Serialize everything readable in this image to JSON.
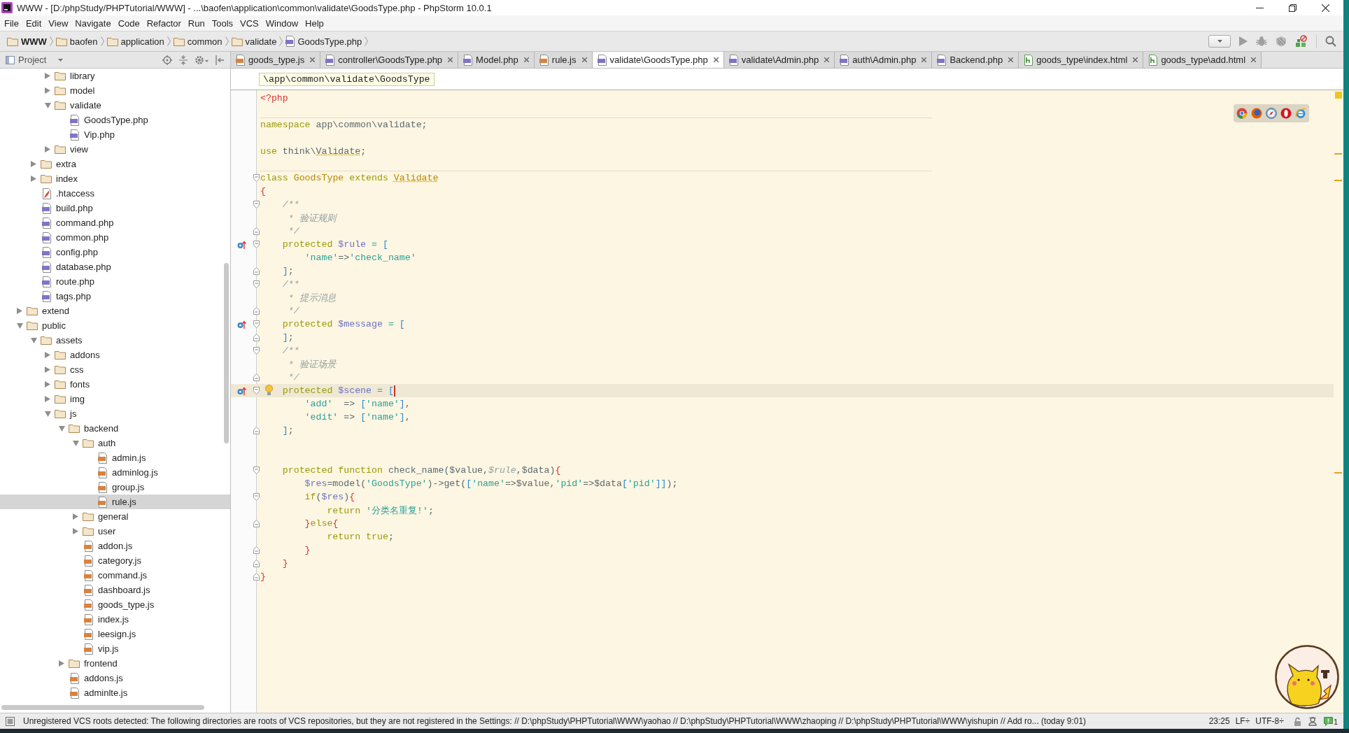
{
  "window": {
    "title": "WWW - [D:/phpStudy/PHPTutorial/WWW] - ...\\baofen\\application\\common\\validate\\GoodsType.php - PhpStorm 10.0.1"
  },
  "menu": [
    "File",
    "Edit",
    "View",
    "Navigate",
    "Code",
    "Refactor",
    "Run",
    "Tools",
    "VCS",
    "Window",
    "Help"
  ],
  "breadcrumb": [
    {
      "label": "WWW",
      "kind": "project"
    },
    {
      "label": "baofen",
      "kind": "folder"
    },
    {
      "label": "application",
      "kind": "folder"
    },
    {
      "label": "common",
      "kind": "folder"
    },
    {
      "label": "validate",
      "kind": "folder"
    },
    {
      "label": "GoodsType.php",
      "kind": "php"
    }
  ],
  "project_panel": {
    "view": "Project",
    "tree": [
      {
        "children": [
          {
            "children": [
              {
                "label": "library",
                "kind": "folder",
                "expanded": false,
                "selected": false
              },
              {
                "label": "model",
                "kind": "folder",
                "expanded": false,
                "selected": false
              },
              {
                "label": "validate",
                "kind": "folder",
                "expanded": true,
                "selected": false,
                "children": [
                  {
                    "label": "GoodsType.php",
                    "kind": "php",
                    "selected": false
                  },
                  {
                    "label": "Vip.php",
                    "kind": "php",
                    "selected": false
                  }
                ]
              },
              {
                "label": "view",
                "kind": "folder",
                "expanded": false,
                "selected": false
              }
            ]
          },
          {
            "label": "extra",
            "kind": "folder",
            "expanded": false,
            "selected": false
          },
          {
            "label": "index",
            "kind": "folder",
            "expanded": false,
            "selected": false
          },
          {
            "label": ".htaccess",
            "kind": "config",
            "selected": false
          },
          {
            "label": "build.php",
            "kind": "php",
            "selected": false
          },
          {
            "label": "command.php",
            "kind": "php",
            "selected": false
          },
          {
            "label": "common.php",
            "kind": "php",
            "selected": false
          },
          {
            "label": "config.php",
            "kind": "php",
            "selected": false
          },
          {
            "label": "database.php",
            "kind": "php",
            "selected": false
          },
          {
            "label": "route.php",
            "kind": "php",
            "selected": false
          },
          {
            "label": "tags.php",
            "kind": "php",
            "selected": false
          }
        ]
      },
      {
        "label": "extend",
        "kind": "folder",
        "expanded": false,
        "selected": false
      },
      {
        "label": "public",
        "kind": "folder",
        "expanded": true,
        "selected": false,
        "children": [
          {
            "label": "assets",
            "kind": "folder",
            "expanded": true,
            "selected": false,
            "children": [
              {
                "label": "addons",
                "kind": "folder",
                "expanded": false,
                "selected": false
              },
              {
                "label": "css",
                "kind": "folder",
                "expanded": false,
                "selected": false
              },
              {
                "label": "fonts",
                "kind": "folder",
                "expanded": false,
                "selected": false
              },
              {
                "label": "img",
                "kind": "folder",
                "expanded": false,
                "selected": false
              },
              {
                "label": "js",
                "kind": "folder",
                "expanded": true,
                "selected": false,
                "children": [
                  {
                    "label": "backend",
                    "kind": "folder",
                    "expanded": true,
                    "selected": false,
                    "children": [
                      {
                        "label": "auth",
                        "kind": "folder",
                        "expanded": true,
                        "selected": false,
                        "children": [
                          {
                            "label": "admin.js",
                            "kind": "js",
                            "selected": false
                          },
                          {
                            "label": "adminlog.js",
                            "kind": "js",
                            "selected": false
                          },
                          {
                            "label": "group.js",
                            "kind": "js",
                            "selected": false
                          },
                          {
                            "label": "rule.js",
                            "kind": "js",
                            "selected": true
                          }
                        ]
                      },
                      {
                        "label": "general",
                        "kind": "folder",
                        "expanded": false,
                        "selected": false
                      },
                      {
                        "label": "user",
                        "kind": "folder",
                        "expanded": false,
                        "selected": false
                      },
                      {
                        "label": "addon.js",
                        "kind": "js",
                        "selected": false
                      },
                      {
                        "label": "category.js",
                        "kind": "js",
                        "selected": false
                      },
                      {
                        "label": "command.js",
                        "kind": "js",
                        "selected": false
                      },
                      {
                        "label": "dashboard.js",
                        "kind": "js",
                        "selected": false
                      },
                      {
                        "label": "goods_type.js",
                        "kind": "js",
                        "selected": false
                      },
                      {
                        "label": "index.js",
                        "kind": "js",
                        "selected": false
                      },
                      {
                        "label": "leesign.js",
                        "kind": "js",
                        "selected": false
                      },
                      {
                        "label": "vip.js",
                        "kind": "js",
                        "selected": false
                      }
                    ]
                  },
                  {
                    "label": "frontend",
                    "kind": "folder",
                    "expanded": false,
                    "selected": false
                  },
                  {
                    "label": "addons.js",
                    "kind": "js",
                    "selected": false
                  },
                  {
                    "label": "adminlte.js",
                    "kind": "js",
                    "selected": false
                  }
                ]
              }
            ]
          }
        ]
      }
    ]
  },
  "tabs": [
    {
      "label": "goods_type.js",
      "kind": "js",
      "selected": false
    },
    {
      "label": "controller\\GoodsType.php",
      "kind": "php",
      "selected": false
    },
    {
      "label": "Model.php",
      "kind": "php",
      "selected": false
    },
    {
      "label": "rule.js",
      "kind": "js",
      "selected": false
    },
    {
      "label": "validate\\GoodsType.php",
      "kind": "php",
      "selected": true
    },
    {
      "label": "validate\\Admin.php",
      "kind": "php",
      "selected": false
    },
    {
      "label": "auth\\Admin.php",
      "kind": "php",
      "selected": false
    },
    {
      "label": "Backend.php",
      "kind": "php",
      "selected": false
    },
    {
      "label": "goods_type\\index.html",
      "kind": "html",
      "selected": false
    },
    {
      "label": "goods_type\\add.html",
      "kind": "html",
      "selected": false
    }
  ],
  "editor": {
    "path_hint": "\\app\\common\\validate\\GoodsType",
    "lines": [
      {
        "tokens": [
          {
            "text": "<?php",
            "kind": "tag"
          }
        ],
        "current": false,
        "separator": false,
        "warning": false
      },
      {
        "current": false,
        "separator": false,
        "warning": false
      },
      {
        "tokens": [
          {
            "text": "namespace",
            "kind": "keyword"
          },
          {
            "text": " app\\common\\validate;",
            "kind": "plain"
          }
        ],
        "current": false,
        "separator": true,
        "warning": false
      },
      {
        "current": false,
        "separator": false,
        "warning": false
      },
      {
        "tokens": [
          {
            "text": "use",
            "kind": "keyword"
          },
          {
            "text": " think\\",
            "kind": "plain"
          },
          {
            "text": "Validate",
            "kind": "ref"
          },
          {
            "text": ";",
            "kind": "plain"
          }
        ],
        "current": false,
        "separator": false,
        "warning": true
      },
      {
        "current": false,
        "separator": false,
        "warning": false
      },
      {
        "markers": [
          {
            "kind": "foldstart"
          }
        ],
        "tokens": [
          {
            "text": "class ",
            "kind": "keyword"
          },
          {
            "text": "GoodsType",
            "kind": "type"
          },
          {
            "text": " extends ",
            "kind": "keyword"
          },
          {
            "text": "Validate",
            "kind": "typeref"
          }
        ],
        "current": false,
        "separator": true,
        "warning": true
      },
      {
        "tokens": [
          {
            "text": "{",
            "kind": "brace"
          }
        ],
        "current": false,
        "separator": false,
        "warning": false,
        "children": [
          {
            "markers": [
              {
                "kind": "foldstart"
              }
            ],
            "tokens": [
              {
                "text": "/**",
                "kind": "comment"
              }
            ],
            "current": false,
            "separator": false,
            "warning": false
          },
          {
            "tokens": [
              {
                "text": " * 验证规则",
                "kind": "comment"
              }
            ],
            "current": false,
            "separator": false,
            "warning": false
          },
          {
            "markers": [
              {
                "kind": "foldend"
              }
            ],
            "tokens": [
              {
                "text": " */",
                "kind": "comment"
              }
            ],
            "current": false,
            "separator": false,
            "warning": false
          },
          {
            "markers": [
              {
                "kind": "override"
              },
              {
                "kind": "foldstart"
              }
            ],
            "tokens": [
              {
                "text": "protected ",
                "kind": "keyword"
              },
              {
                "text": "$rule",
                "kind": "variable"
              },
              {
                "text": " = ",
                "kind": "operator"
              },
              {
                "text": "[",
                "kind": "bracket"
              }
            ],
            "current": false,
            "separator": false,
            "warning": false,
            "children": [
              {
                "tokens": [
                  {
                    "text": "'name'",
                    "kind": "string"
                  },
                  {
                    "text": "=>",
                    "kind": "plain"
                  },
                  {
                    "text": "'check_name'",
                    "kind": "string"
                  }
                ],
                "current": false,
                "separator": false,
                "warning": false
              }
            ]
          },
          {
            "markers": [
              {
                "kind": "foldend"
              }
            ],
            "tokens": [
              {
                "text": "]",
                "kind": "bracket"
              },
              {
                "text": ";",
                "kind": "plain"
              }
            ],
            "current": false,
            "separator": false,
            "warning": false
          },
          {
            "markers": [
              {
                "kind": "foldstart"
              }
            ],
            "tokens": [
              {
                "text": "/**",
                "kind": "comment"
              }
            ],
            "current": false,
            "separator": false,
            "warning": false
          },
          {
            "tokens": [
              {
                "text": " * 提示消息",
                "kind": "comment"
              }
            ],
            "current": false,
            "separator": false,
            "warning": false
          },
          {
            "markers": [
              {
                "kind": "foldend"
              }
            ],
            "tokens": [
              {
                "text": " */",
                "kind": "comment"
              }
            ],
            "current": false,
            "separator": false,
            "warning": false
          },
          {
            "markers": [
              {
                "kind": "override"
              },
              {
                "kind": "foldstart"
              }
            ],
            "tokens": [
              {
                "text": "protected ",
                "kind": "keyword"
              },
              {
                "text": "$message",
                "kind": "variable"
              },
              {
                "text": " = ",
                "kind": "operator"
              },
              {
                "text": "[",
                "kind": "bracket"
              }
            ],
            "current": false,
            "separator": false,
            "warning": false
          },
          {
            "markers": [
              {
                "kind": "foldend"
              }
            ],
            "tokens": [
              {
                "text": "]",
                "kind": "bracket"
              },
              {
                "text": ";",
                "kind": "plain"
              }
            ],
            "current": false,
            "separator": false,
            "warning": false
          },
          {
            "markers": [
              {
                "kind": "foldstart"
              }
            ],
            "tokens": [
              {
                "text": "/**",
                "kind": "comment"
              }
            ],
            "current": false,
            "separator": false,
            "warning": false
          },
          {
            "tokens": [
              {
                "text": " * 验证场景",
                "kind": "comment"
              }
            ],
            "current": false,
            "separator": false,
            "warning": false
          },
          {
            "markers": [
              {
                "kind": "foldend"
              }
            ],
            "tokens": [
              {
                "text": " */",
                "kind": "comment"
              }
            ],
            "current": false,
            "separator": false,
            "warning": false
          },
          {
            "markers": [
              {
                "kind": "override"
              },
              {
                "kind": "foldstart"
              },
              {
                "kind": "bulb"
              }
            ],
            "tokens": [
              {
                "text": "protected ",
                "kind": "keyword"
              },
              {
                "text": "$scene",
                "kind": "variable"
              },
              {
                "text": " = ",
                "kind": "operator"
              },
              {
                "text": "[",
                "kind": "bracket"
              }
            ],
            "current": true,
            "separator": false,
            "warning": false,
            "children": [
              {
                "tokens": [
                  {
                    "text": "'add'",
                    "kind": "string"
                  },
                  {
                    "text": "  => ",
                    "kind": "plain"
                  },
                  {
                    "text": "[",
                    "kind": "bracket"
                  },
                  {
                    "text": "'name'",
                    "kind": "string"
                  },
                  {
                    "text": "]",
                    "kind": "bracket"
                  },
                  {
                    "text": ",",
                    "kind": "plain"
                  }
                ],
                "current": false,
                "separator": false,
                "warning": false
              },
              {
                "tokens": [
                  {
                    "text": "'edit'",
                    "kind": "string"
                  },
                  {
                    "text": " => ",
                    "kind": "plain"
                  },
                  {
                    "text": "[",
                    "kind": "bracket"
                  },
                  {
                    "text": "'name'",
                    "kind": "string"
                  },
                  {
                    "text": "]",
                    "kind": "bracket"
                  },
                  {
                    "text": ",",
                    "kind": "plain"
                  }
                ],
                "current": false,
                "separator": false,
                "warning": false
              }
            ]
          },
          {
            "markers": [
              {
                "kind": "foldend"
              }
            ],
            "tokens": [
              {
                "text": "]",
                "kind": "bracket"
              },
              {
                "text": ";",
                "kind": "plain"
              }
            ],
            "current": false,
            "separator": false,
            "warning": false
          },
          {
            "current": false,
            "separator": false,
            "warning": false
          },
          {
            "current": false,
            "separator": false,
            "warning": false
          },
          {
            "markers": [
              {
                "kind": "foldstart"
              }
            ],
            "tokens": [
              {
                "text": "protected function ",
                "kind": "keyword"
              },
              {
                "text": "check_name($value,",
                "kind": "plain"
              },
              {
                "text": "$rule",
                "kind": "unused"
              },
              {
                "text": ",$data)",
                "kind": "plain"
              },
              {
                "text": "{",
                "kind": "brace"
              }
            ],
            "current": false,
            "separator": false,
            "warning": true,
            "children": [
              {
                "tokens": [
                  {
                    "text": "$res",
                    "kind": "variable"
                  },
                  {
                    "text": "=model(",
                    "kind": "plain"
                  },
                  {
                    "text": "'GoodsType'",
                    "kind": "string"
                  },
                  {
                    "text": ")->get(",
                    "kind": "plain"
                  },
                  {
                    "text": "[",
                    "kind": "bracket"
                  },
                  {
                    "text": "'name'",
                    "kind": "string"
                  },
                  {
                    "text": "=>$value,",
                    "kind": "plain"
                  },
                  {
                    "text": "'pid'",
                    "kind": "string"
                  },
                  {
                    "text": "=>$data",
                    "kind": "plain"
                  },
                  {
                    "text": "[",
                    "kind": "bracket"
                  },
                  {
                    "text": "'pid'",
                    "kind": "string"
                  },
                  {
                    "text": "]]",
                    "kind": "bracket"
                  },
                  {
                    "text": ");",
                    "kind": "plain"
                  }
                ],
                "current": false,
                "separator": false,
                "warning": false
              },
              {
                "markers": [
                  {
                    "kind": "foldstart"
                  }
                ],
                "tokens": [
                  {
                    "text": "if",
                    "kind": "keyword"
                  },
                  {
                    "text": "(",
                    "kind": "plain"
                  },
                  {
                    "text": "$res",
                    "kind": "variable"
                  },
                  {
                    "text": ")",
                    "kind": "plain"
                  },
                  {
                    "text": "{",
                    "kind": "brace"
                  }
                ],
                "current": false,
                "separator": false,
                "warning": false,
                "children": [
                  {
                    "tokens": [
                      {
                        "text": "return ",
                        "kind": "keyword"
                      },
                      {
                        "text": "'分类名重复!'",
                        "kind": "string"
                      },
                      {
                        "text": ";",
                        "kind": "plain"
                      }
                    ],
                    "current": false,
                    "separator": false,
                    "warning": false
                  }
                ]
              },
              {
                "markers": [
                  {
                    "kind": "foldend"
                  }
                ],
                "tokens": [
                  {
                    "text": "}",
                    "kind": "brace"
                  },
                  {
                    "text": "else",
                    "kind": "keyword"
                  },
                  {
                    "text": "{",
                    "kind": "brace"
                  }
                ],
                "current": false,
                "separator": false,
                "warning": false,
                "children": [
                  {
                    "tokens": [
                      {
                        "text": "return true",
                        "kind": "keyword"
                      },
                      {
                        "text": ";",
                        "kind": "plain"
                      }
                    ],
                    "current": false,
                    "separator": false,
                    "warning": false
                  }
                ]
              },
              {
                "markers": [
                  {
                    "kind": "foldend"
                  }
                ],
                "tokens": [
                  {
                    "text": "}",
                    "kind": "brace"
                  }
                ],
                "current": false,
                "separator": false,
                "warning": false
              }
            ]
          },
          {
            "markers": [
              {
                "kind": "foldend"
              }
            ],
            "tokens": [
              {
                "text": "}",
                "kind": "brace"
              }
            ],
            "current": false,
            "separator": false,
            "warning": false
          }
        ]
      },
      {
        "markers": [
          {
            "kind": "foldend"
          }
        ],
        "tokens": [
          {
            "text": "}",
            "kind": "brace"
          }
        ],
        "current": false,
        "separator": false,
        "warning": false
      }
    ]
  },
  "status_bar": {
    "message": "Unregistered VCS roots detected: The following directories are roots of VCS repositories, but they are not registered in the Settings: // D:\\phpStudy\\PHPTutorial\\WWW\\yaohao // D:\\phpStudy\\PHPTutorial\\WWW\\zhaoping // D:\\phpStudy\\PHPTutorial\\WWW\\yishupin // Add ro... (today 9:01)",
    "caret": "23:25",
    "line_separator": "LF÷",
    "encoding": "UTF-8÷",
    "notifications": "1"
  }
}
